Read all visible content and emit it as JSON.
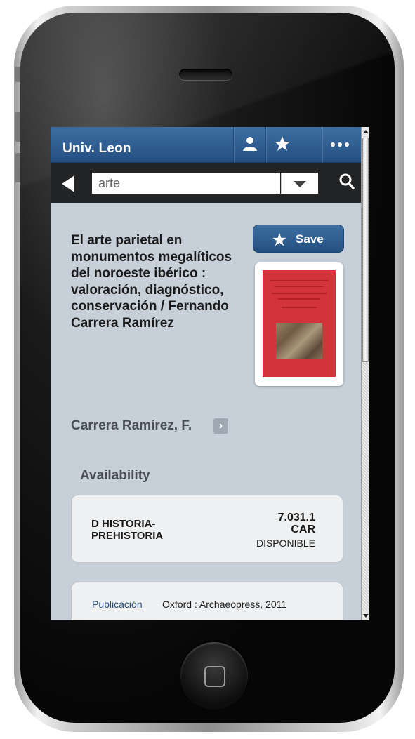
{
  "app": {
    "title": "Univ. Leon"
  },
  "toolbar": {
    "account_icon": "person-icon",
    "favorites_icon": "star-icon",
    "more_icon": "ellipsis-icon"
  },
  "search": {
    "value": "arte",
    "back_icon": "back-arrow-icon",
    "dropdown_icon": "chevron-down-icon",
    "search_icon": "search-icon"
  },
  "record": {
    "title": "El arte parietal en monumentos megalíticos del noroeste ibérico : valoración, diagnóstico, conservación / Fernando Carrera Ramírez",
    "save_label": "Save",
    "author": "Carrera Ramírez, F.",
    "author_arrow": "›"
  },
  "availability": {
    "heading": "Availability",
    "items": [
      {
        "location_line1": "D HISTORIA-",
        "location_line2": "PREHISTORIA",
        "call_line1": "7.031.1",
        "call_line2": "CAR",
        "status": "DISPONIBLE"
      }
    ]
  },
  "details": {
    "publication_label": "Publicación",
    "publication_value": "Oxford : Archaeopress, 2011"
  },
  "colors": {
    "brand_blue": "#2f5f94",
    "cover_red": "#d3333b",
    "background": "#c7d0d9"
  }
}
